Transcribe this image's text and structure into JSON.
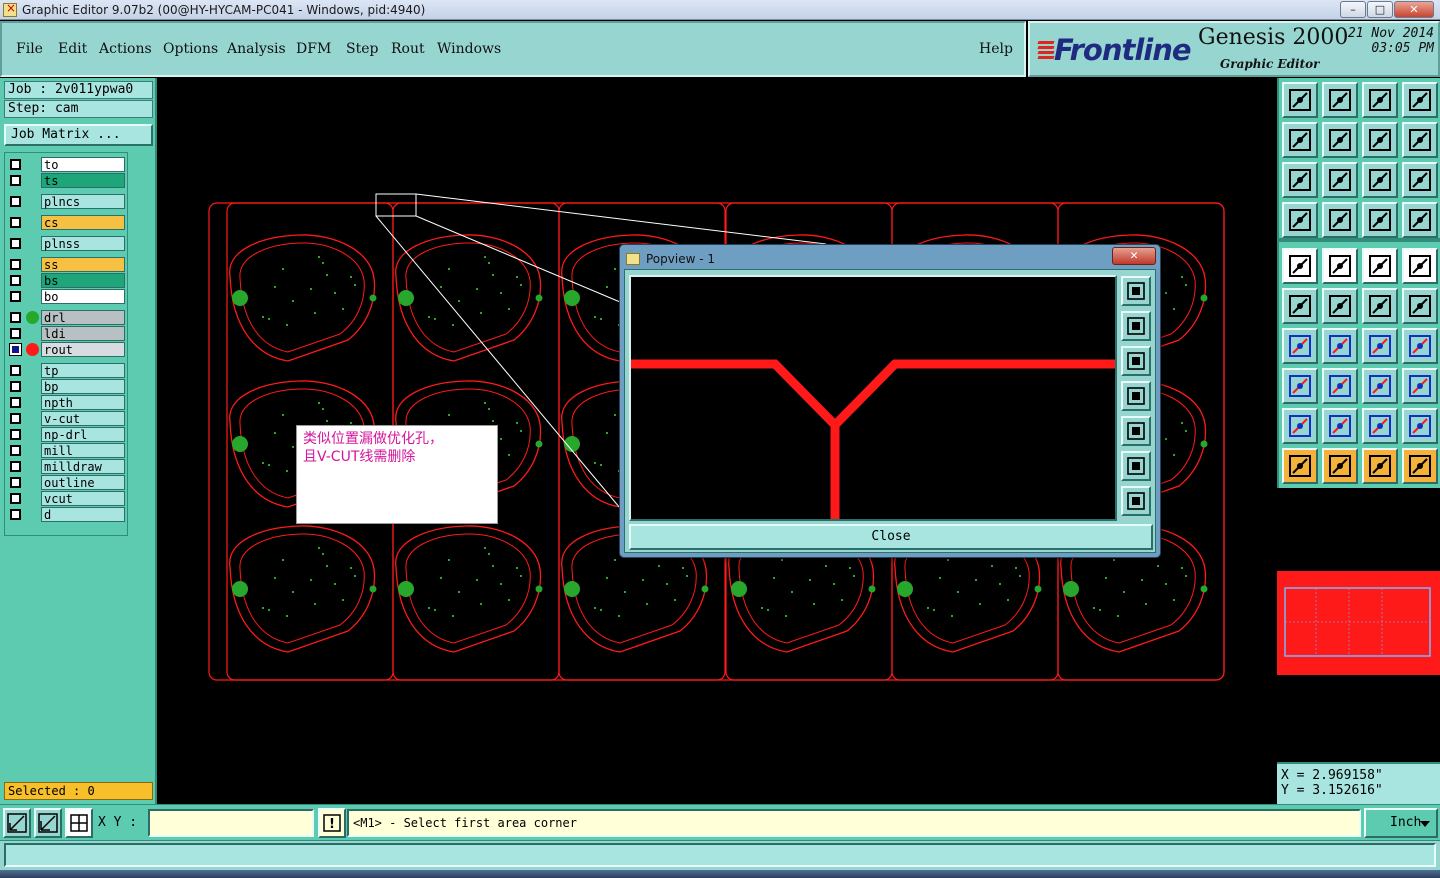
{
  "window": {
    "title": "Graphic Editor 9.07b2 (00@HY-HYCAM-PC041 - Windows, pid:4940)",
    "controls": [
      "–",
      "□",
      "✕"
    ]
  },
  "menu": {
    "items": [
      {
        "label": "File",
        "key": "F"
      },
      {
        "label": "Edit",
        "key": "E"
      },
      {
        "label": "Actions",
        "key": "A"
      },
      {
        "label": "Options",
        "key": "O"
      },
      {
        "label": "Analysis",
        "key": ""
      },
      {
        "label": "DFM",
        "key": ""
      },
      {
        "label": "Step",
        "key": "S"
      },
      {
        "label": "Rout",
        "key": "R"
      },
      {
        "label": "Windows",
        "key": "W"
      }
    ],
    "help": "Help"
  },
  "brand": {
    "logo": "Frontline",
    "product": "Genesis 2000",
    "subtitle": "Graphic Editor",
    "date": "21 Nov 2014",
    "time": "03:05 PM"
  },
  "job": {
    "job_line": "Job : 2v011ypwa0",
    "step_line": "Step: cam",
    "matrix_button": "Job Matrix ..."
  },
  "layers": [
    {
      "name": "to",
      "color": "#ffffff",
      "checked": false,
      "dot": ""
    },
    {
      "name": "ts",
      "color": "#1ea57a",
      "checked": false,
      "dot": ""
    },
    {
      "name": "plncs",
      "color": "#a9e5e0",
      "checked": false,
      "dot": ""
    },
    {
      "name": "cs",
      "color": "#f6c043",
      "checked": false,
      "dot": ""
    },
    {
      "name": "plnss",
      "color": "#a9e5e0",
      "checked": false,
      "dot": ""
    },
    {
      "name": "ss",
      "color": "#f6c043",
      "checked": false,
      "dot": ""
    },
    {
      "name": "bs",
      "color": "#1ea57a",
      "checked": false,
      "dot": ""
    },
    {
      "name": "bo",
      "color": "#ffffff",
      "checked": false,
      "dot": ""
    },
    {
      "name": "drl",
      "color": "#b8c0c4",
      "checked": false,
      "dot": "#27a72b"
    },
    {
      "name": "ldi",
      "color": "#b8c0c4",
      "checked": false,
      "dot": ""
    },
    {
      "name": "rout",
      "color": "#d6dcdf",
      "checked": true,
      "dot": "#ff1a1a",
      "mark": "▣"
    },
    {
      "name": "tp",
      "color": "#a9e5e0",
      "checked": false,
      "dot": ""
    },
    {
      "name": "bp",
      "color": "#a9e5e0",
      "checked": false,
      "dot": ""
    },
    {
      "name": "npth",
      "color": "#a9e5e0",
      "checked": false,
      "dot": ""
    },
    {
      "name": "v-cut",
      "color": "#a9e5e0",
      "checked": false,
      "dot": ""
    },
    {
      "name": "np-drl",
      "color": "#a9e5e0",
      "checked": false,
      "dot": ""
    },
    {
      "name": "mill",
      "color": "#a9e5e0",
      "checked": false,
      "dot": ""
    },
    {
      "name": "milldraw",
      "color": "#a9e5e0",
      "checked": false,
      "dot": "",
      "mark": "✎"
    },
    {
      "name": "outline",
      "color": "#a9e5e0",
      "checked": false,
      "dot": ""
    },
    {
      "name": "vcut",
      "color": "#a9e5e0",
      "checked": false,
      "dot": ""
    },
    {
      "name": "d",
      "color": "#a9e5e0",
      "checked": false,
      "dot": ""
    }
  ],
  "selected": "Selected : 0",
  "popview": {
    "title": "Popview - 1",
    "close_x": "✕",
    "close_button": "Close"
  },
  "note": {
    "line1": "类似位置漏做优化孔，",
    "line2": "且V-CUT线需删除"
  },
  "coords": {
    "x": "X = 2.969158\"",
    "y": "Y = 3.152616\""
  },
  "status": {
    "xy_label": "X Y :",
    "xy_value": "",
    "alert_icon": "!",
    "message": "<M1> - Select first area corner",
    "unit": "Inch"
  },
  "colors": {
    "rout_red": "#ff1a1a",
    "drill_green": "#27a72b",
    "panel_teal": "#5ccbb0",
    "menu_teal": "#97d6d0"
  }
}
